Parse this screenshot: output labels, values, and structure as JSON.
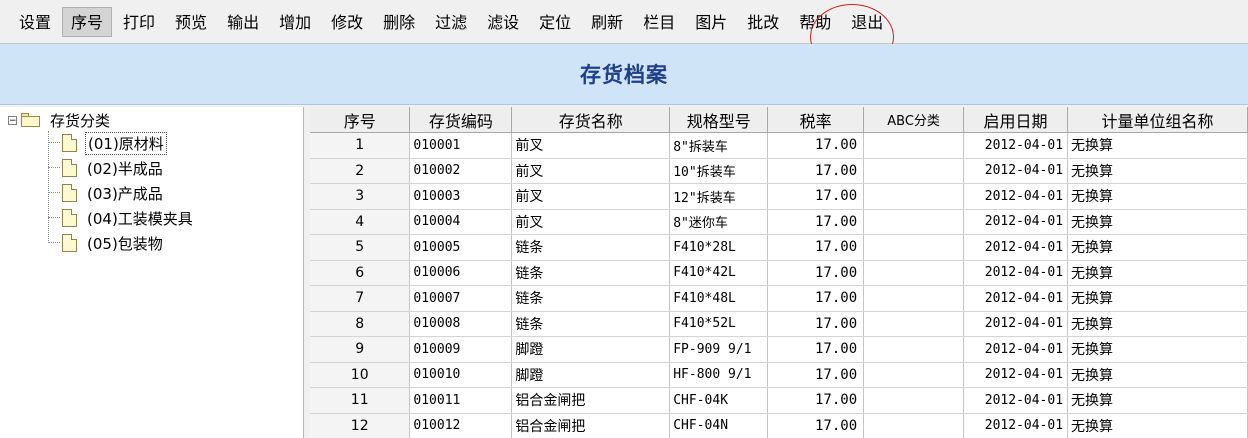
{
  "toolbar": {
    "buttons": [
      {
        "label": "设置"
      },
      {
        "label": "序号"
      },
      {
        "label": "打印"
      },
      {
        "label": "预览"
      },
      {
        "label": "输出"
      },
      {
        "label": "增加"
      },
      {
        "label": "修改"
      },
      {
        "label": "删除"
      },
      {
        "label": "过滤"
      },
      {
        "label": "滤设"
      },
      {
        "label": "定位"
      },
      {
        "label": "刷新"
      },
      {
        "label": "栏目"
      },
      {
        "label": "图片"
      },
      {
        "label": "批改"
      },
      {
        "label": "帮助"
      },
      {
        "label": "退出"
      }
    ]
  },
  "title": "存货档案",
  "tree": {
    "root": {
      "label": "存货分类",
      "expander": "−"
    },
    "items": [
      {
        "label": "(01)原材料"
      },
      {
        "label": "(02)半成品"
      },
      {
        "label": "(03)产成品"
      },
      {
        "label": "(04)工装模夹具"
      },
      {
        "label": "(05)包装物"
      }
    ]
  },
  "table": {
    "columns": [
      "序号",
      "存货编码",
      "存货名称",
      "规格型号",
      "税率",
      "ABC分类",
      "启用日期",
      "计量单位组名称"
    ],
    "rows": [
      [
        "1",
        "010001",
        "前叉",
        "8\"拆装车",
        "17.00",
        "",
        "2012-04-01",
        "无换算"
      ],
      [
        "2",
        "010002",
        "前叉",
        "10\"拆装车",
        "17.00",
        "",
        "2012-04-01",
        "无换算"
      ],
      [
        "3",
        "010003",
        "前叉",
        "12\"拆装车",
        "17.00",
        "",
        "2012-04-01",
        "无换算"
      ],
      [
        "4",
        "010004",
        "前叉",
        "8\"迷你车",
        "17.00",
        "",
        "2012-04-01",
        "无换算"
      ],
      [
        "5",
        "010005",
        "链条",
        "F410*28L",
        "17.00",
        "",
        "2012-04-01",
        "无换算"
      ],
      [
        "6",
        "010006",
        "链条",
        "F410*42L",
        "17.00",
        "",
        "2012-04-01",
        "无换算"
      ],
      [
        "7",
        "010007",
        "链条",
        "F410*48L",
        "17.00",
        "",
        "2012-04-01",
        "无换算"
      ],
      [
        "8",
        "010008",
        "链条",
        "F410*52L",
        "17.00",
        "",
        "2012-04-01",
        "无换算"
      ],
      [
        "9",
        "010009",
        "脚蹬",
        "FP-909 9/1",
        "17.00",
        "",
        "2012-04-01",
        "无换算"
      ],
      [
        "10",
        "010010",
        "脚蹬",
        "HF-800 9/1",
        "17.00",
        "",
        "2012-04-01",
        "无换算"
      ],
      [
        "11",
        "010011",
        "铝合金闸把",
        "CHF-04K",
        "17.00",
        "",
        "2012-04-01",
        "无换算"
      ],
      [
        "12",
        "010012",
        "铝合金闸把",
        "CHF-04N",
        "17.00",
        "",
        "2012-04-01",
        "无换算"
      ]
    ]
  }
}
